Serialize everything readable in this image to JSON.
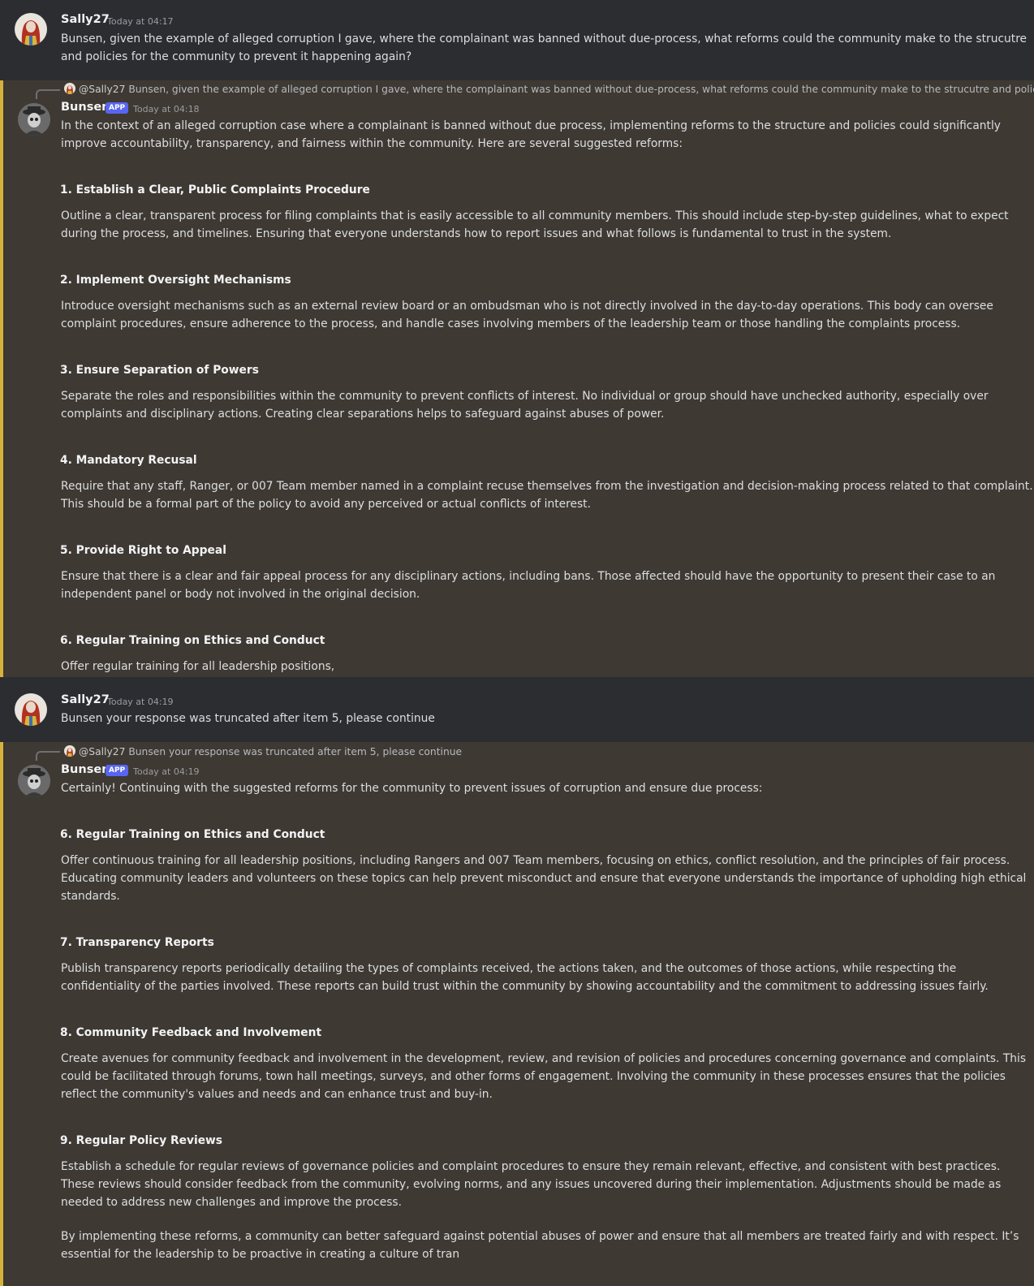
{
  "messages": [
    {
      "author": "Sally27",
      "timestamp": "Today at 04:17",
      "lines": [
        "Bunsen, given the example of alleged corruption I gave, where the complainant was banned without due-process, what reforms could the community make to the strucutre",
        "and policies for the community to prevent it happening again?"
      ]
    },
    {
      "author": "Bunsen",
      "badge": "APP",
      "timestamp": "Today at 04:18",
      "reply_to": {
        "mention": "@Sally27",
        "text": "Bunsen, given the example of alleged corruption I gave, where the complainant was banned without due-process, what reforms could the community make to the strucutre and polici..."
      },
      "intro": [
        "In the context of an alleged corruption case where a complainant is banned without due process, implementing reforms to the structure and policies could significantly",
        "improve accountability, transparency, and fairness within the community. Here are several suggested reforms:"
      ],
      "sections": [
        {
          "heading": "1. Establish a Clear, Public Complaints Procedure",
          "lines": [
            "Outline a clear, transparent process for filing complaints that is easily accessible to all community members. This should include step-by-step guidelines, what to expect",
            "during the process, and timelines. Ensuring that everyone understands how to report issues and what follows is fundamental to trust in the system."
          ]
        },
        {
          "heading": "2. Implement Oversight Mechanisms",
          "lines": [
            "Introduce oversight mechanisms such as an external review board or an ombudsman who is not directly involved in the day-to-day operations. This body can oversee",
            "complaint procedures, ensure adherence to the process, and handle cases involving members of the leadership team or those handling the complaints process."
          ]
        },
        {
          "heading": "3. Ensure Separation of Powers",
          "lines": [
            "Separate the roles and responsibilities within the community to prevent conflicts of interest. No individual or group should have unchecked authority, especially over",
            "complaints and disciplinary actions. Creating clear separations helps to safeguard against abuses of power."
          ]
        },
        {
          "heading": "4. Mandatory Recusal",
          "lines": [
            "Require that any staff, Ranger, or 007 Team member named in a complaint recuse themselves from the investigation and decision-making process related to that complaint.",
            "This should be a formal part of the policy to avoid any perceived or actual conflicts of interest."
          ]
        },
        {
          "heading": "5. Provide Right to Appeal",
          "lines": [
            "Ensure that there is a clear and fair appeal process for any disciplinary actions, including bans. Those affected should have the opportunity to present their case to an",
            "independent panel or body not involved in the original decision."
          ]
        },
        {
          "heading": "6. Regular Training on Ethics and Conduct",
          "lines": [
            "Offer regular training for all leadership positions,"
          ]
        }
      ]
    },
    {
      "author": "Sally27",
      "timestamp": "Today at 04:19",
      "lines": [
        "Bunsen your response was truncated after item 5, please continue"
      ]
    },
    {
      "author": "Bunsen",
      "badge": "APP",
      "timestamp": "Today at 04:19",
      "reply_to": {
        "mention": "@Sally27",
        "text": "Bunsen your response was truncated after item 5, please continue"
      },
      "intro": [
        "Certainly! Continuing with the suggested reforms for the community to prevent issues of corruption and ensure due process:"
      ],
      "sections": [
        {
          "heading": "6. Regular Training on Ethics and Conduct",
          "lines": [
            "Offer continuous training for all leadership positions, including Rangers and 007 Team members, focusing on ethics, conflict resolution, and the principles of fair process.",
            "Educating community leaders and volunteers on these topics can help prevent misconduct and ensure that everyone understands the importance of upholding high ethical",
            "standards."
          ]
        },
        {
          "heading": "7. Transparency Reports",
          "lines": [
            "Publish transparency reports periodically detailing the types of complaints received, the actions taken, and the outcomes of those actions, while respecting the",
            "confidentiality of the parties involved. These reports can build trust within the community by showing accountability and the commitment to addressing issues fairly."
          ]
        },
        {
          "heading": "8. Community Feedback and Involvement",
          "lines": [
            "Create avenues for community feedback and involvement in the development, review, and revision of policies and procedures concerning governance and complaints. This",
            "could be facilitated through forums, town hall meetings, surveys, and other forms of engagement. Involving the community in these processes ensures that the policies",
            "reflect the community's values and needs and can enhance trust and buy-in."
          ]
        },
        {
          "heading": "9. Regular Policy Reviews",
          "lines": [
            "Establish a schedule for regular reviews of governance policies and complaint procedures to ensure they remain relevant, effective, and consistent with best practices.",
            "These reviews should consider feedback from the community, evolving norms, and any issues uncovered during their implementation. Adjustments should be made as",
            "needed to address new challenges and improve the process."
          ]
        }
      ],
      "outro": [
        "By implementing these reforms, a community can better safeguard against potential abuses of power and ensure that all members are treated fairly and with respect. It’s",
        "essential for the leadership to be proactive in creating a culture of tran"
      ]
    }
  ]
}
